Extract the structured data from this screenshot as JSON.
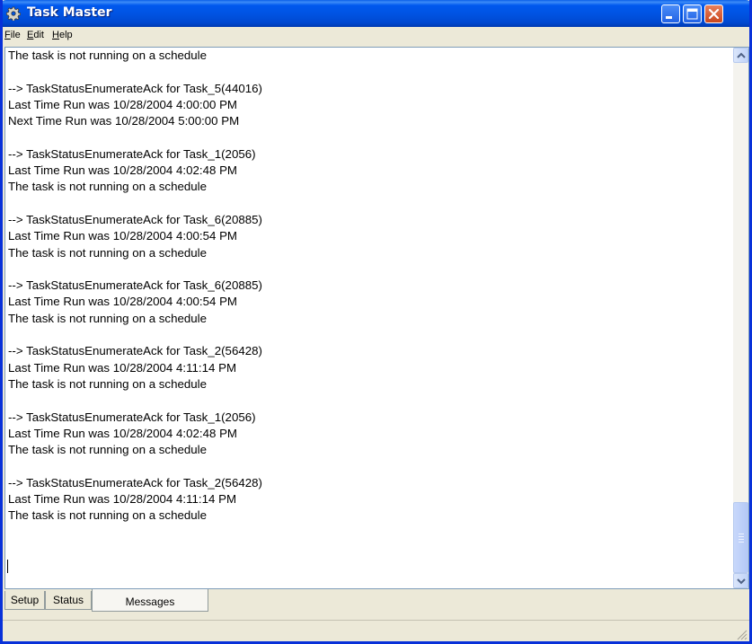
{
  "window": {
    "title": "Task Master",
    "icon": "gear-icon"
  },
  "menu": {
    "file": {
      "underline": "F",
      "rest": "ile"
    },
    "edit": {
      "underline": "E",
      "rest": "dit"
    },
    "help": {
      "underline": "H",
      "rest": "elp"
    }
  },
  "messages": [
    "The task is not running on a schedule",
    "",
    "--> TaskStatusEnumerateAck for Task_5(44016)",
    "Last Time Run was 10/28/2004 4:00:00 PM",
    "Next Time Run was 10/28/2004 5:00:00 PM",
    "",
    "--> TaskStatusEnumerateAck for Task_1(2056)",
    "Last Time Run was 10/28/2004 4:02:48 PM",
    "The task is not running on a schedule",
    "",
    "--> TaskStatusEnumerateAck for Task_6(20885)",
    "Last Time Run was 10/28/2004 4:00:54 PM",
    "The task is not running on a schedule",
    "",
    "--> TaskStatusEnumerateAck for Task_6(20885)",
    "Last Time Run was 10/28/2004 4:00:54 PM",
    "The task is not running on a schedule",
    "",
    "--> TaskStatusEnumerateAck for Task_2(56428)",
    "Last Time Run was 10/28/2004 4:11:14 PM",
    "The task is not running on a schedule",
    "",
    "--> TaskStatusEnumerateAck for Task_1(2056)",
    "Last Time Run was 10/28/2004 4:02:48 PM",
    "The task is not running on a schedule",
    "",
    "--> TaskStatusEnumerateAck for Task_2(56428)",
    "Last Time Run was 10/28/2004 4:11:14 PM",
    "The task is not running on a schedule"
  ],
  "tabs": [
    {
      "label": "Setup",
      "active": false
    },
    {
      "label": "Status",
      "active": false
    },
    {
      "label": "Messages",
      "active": true
    }
  ],
  "colors": {
    "title_bar": "#0054e3",
    "window_frame": "#0831d9",
    "close_button": "#c9461d",
    "face": "#ece9d8"
  }
}
